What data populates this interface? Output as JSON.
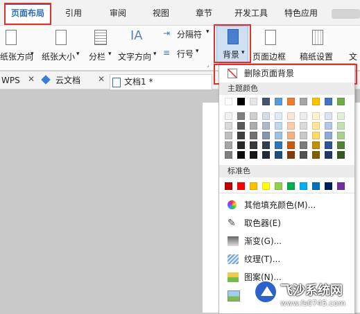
{
  "tabs": [
    {
      "label": "页面布局",
      "active": true
    },
    {
      "label": "引用",
      "active": false
    },
    {
      "label": "审阅",
      "active": false
    },
    {
      "label": "视图",
      "active": false
    },
    {
      "label": "章节",
      "active": false
    },
    {
      "label": "开发工具",
      "active": false
    },
    {
      "label": "特色应用",
      "active": false
    }
  ],
  "ribbon": {
    "paper_orientation": "纸张方向",
    "paper_size": "纸张大小",
    "columns": "分栏",
    "text_direction": "文字方向",
    "separator": "分隔符",
    "line_number": "行号",
    "background": "背景",
    "page_border": "页面边框",
    "manuscript": "稿纸设置",
    "text_cut": "文"
  },
  "doc_tabs": [
    {
      "label": "WPS"
    },
    {
      "label": "云文档"
    },
    {
      "label": "文档1 *"
    }
  ],
  "dropdown": {
    "remove_bg": "删除页面背景",
    "theme_colors_title": "主题颜色",
    "standard_colors_title": "标准色",
    "theme_top": [
      "#ffffff",
      "#000000",
      "#e7e6e6",
      "#44546a",
      "#5b9bd5",
      "#ed7d31",
      "#a5a5a5",
      "#ffc000",
      "#4472c4",
      "#70ad47"
    ],
    "theme_shades": [
      [
        "#f2f2f2",
        "#7f7f7f",
        "#d0cece",
        "#d6dce4",
        "#deebf6",
        "#fbe5d5",
        "#ededed",
        "#fff2cc",
        "#dae3f3",
        "#e2efd9"
      ],
      [
        "#d9d9d9",
        "#595959",
        "#aeabab",
        "#adb9ca",
        "#bdd7ee",
        "#f8cbad",
        "#dbdbdb",
        "#fee599",
        "#b4c6e7",
        "#c5e0b3"
      ],
      [
        "#bfbfbf",
        "#3f3f3f",
        "#757070",
        "#8496b0",
        "#9cc3e5",
        "#f4b183",
        "#c9c9c9",
        "#ffd965",
        "#8eaadb",
        "#a8d08d"
      ],
      [
        "#a5a5a5",
        "#262626",
        "#3a3838",
        "#323f4f",
        "#2e75b5",
        "#c55a11",
        "#7b7b7b",
        "#bf9000",
        "#2f5496",
        "#538135"
      ],
      [
        "#7f7f7f",
        "#0c0c0c",
        "#171616",
        "#222a35",
        "#1e4e79",
        "#833c0b",
        "#525252",
        "#7f6000",
        "#1f3864",
        "#375623"
      ]
    ],
    "standard": [
      "#c00000",
      "#ff0000",
      "#ffc000",
      "#ffff00",
      "#92d050",
      "#00b050",
      "#00b0f0",
      "#0070c0",
      "#002060",
      "#7030a0"
    ],
    "items": [
      {
        "label": "其他填充颜色(M)...",
        "icon": "color-wheel-icon"
      },
      {
        "label": "取色器(E)",
        "icon": "eyedropper-icon"
      },
      {
        "label": "渐变(G)...",
        "icon": "gradient-icon"
      },
      {
        "label": "纹理(T)...",
        "icon": "texture-icon"
      },
      {
        "label": "图案(N)...",
        "icon": "pattern-icon"
      },
      {
        "label": "",
        "icon": "picture-icon"
      }
    ]
  },
  "watermark": {
    "title": "飞沙系统网",
    "url": "www.fs0745.com"
  }
}
